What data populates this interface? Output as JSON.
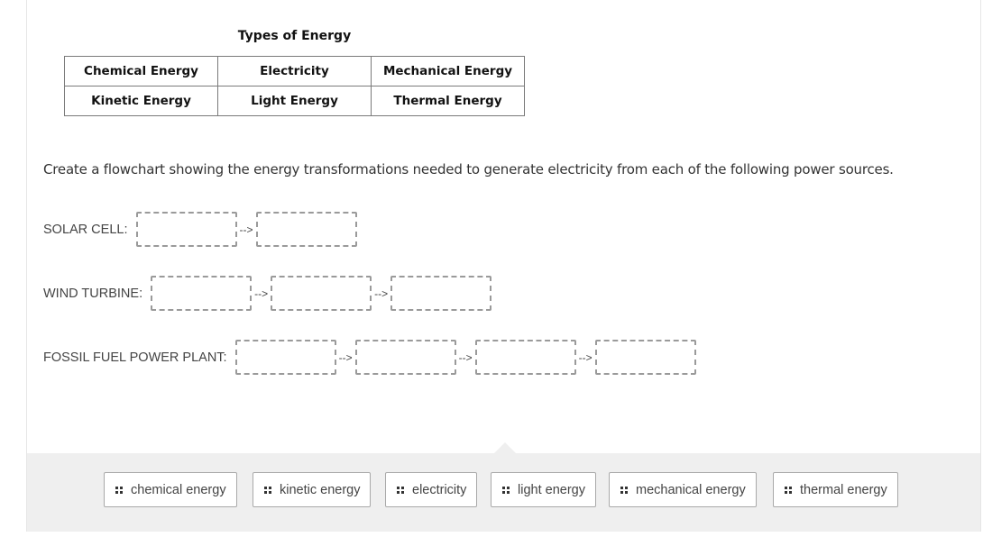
{
  "energy_table": {
    "caption": "Types of Energy",
    "rows": [
      [
        "Chemical Energy",
        "Electricity",
        "Mechanical Energy"
      ],
      [
        "Kinetic Energy",
        "Light Energy",
        "Thermal Energy"
      ]
    ]
  },
  "prompt": "Create a flowchart showing the energy transformations needed to generate electricity from each of the following power sources.",
  "arrow_text": "-->",
  "flowcharts": [
    {
      "label": "SOLAR CELL:",
      "slots": 2
    },
    {
      "label": "WIND TURBINE:",
      "slots": 3
    },
    {
      "label": "FOSSIL FUEL POWER PLANT:",
      "slots": 4
    }
  ],
  "answer_bank": {
    "chips": [
      {
        "label": "chemical energy",
        "icon": "drag-handle-icon"
      },
      {
        "label": "kinetic energy",
        "icon": "drag-handle-icon"
      },
      {
        "label": "electricity",
        "icon": "drag-handle-icon"
      },
      {
        "label": "light energy",
        "icon": "drag-handle-icon"
      },
      {
        "label": "mechanical energy",
        "icon": "drag-handle-icon"
      },
      {
        "label": "thermal energy",
        "icon": "drag-handle-icon"
      }
    ]
  }
}
